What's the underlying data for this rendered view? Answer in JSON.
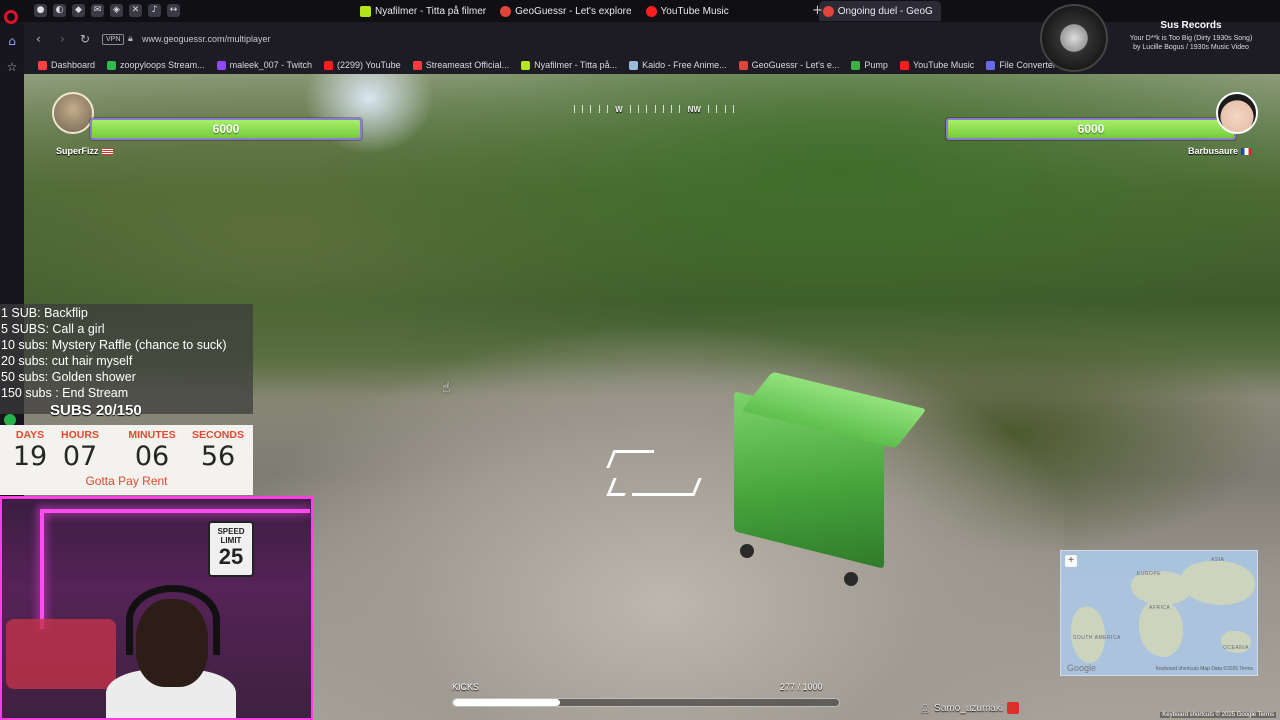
{
  "browser": {
    "tabs": [
      {
        "title": "Nyafilmer - Titta på filmer",
        "color": "#b5e61d"
      },
      {
        "title": "GeoGuessr - Let's explore",
        "color": "#e0453a"
      },
      {
        "title": "YouTube Music",
        "color": "#ff1e1e"
      },
      {
        "title": "Ongoing duel - GeoG",
        "color": "#e0453a",
        "active": true
      }
    ],
    "url": "www.geoguessr.com/multiplayer",
    "vpn_label": "VPN",
    "bookmarks": [
      {
        "label": "Dashboard",
        "color": "#ff4343"
      },
      {
        "label": "zoopyloops Stream...",
        "color": "#2dba4e"
      },
      {
        "label": "maleek_007 - Twitch",
        "color": "#9146ff"
      },
      {
        "label": "(2299) YouTube",
        "color": "#ff1e1e"
      },
      {
        "label": "Streameast Official...",
        "color": "#ff3a3a"
      },
      {
        "label": "Nyafilmer - Titta på...",
        "color": "#b5e61d"
      },
      {
        "label": "Kaido - Free Anime...",
        "color": "#9bd"
      },
      {
        "label": "GeoGuessr - Let's e...",
        "color": "#e0453a"
      },
      {
        "label": "Pump",
        "color": "#3cb043"
      },
      {
        "label": "YouTube Music",
        "color": "#ff1e1e"
      },
      {
        "label": "File Converter - Free...",
        "color": "#6a6af0"
      }
    ]
  },
  "now_playing": {
    "title": "Sus Records",
    "line1": "Your D**k is Too Big (Dirty 1930s Song)",
    "line2": "by Lucille Bogus / 1930s Music Video"
  },
  "duel": {
    "left_player": {
      "name": "SuperFizz",
      "health": "6000",
      "health_fraction": 1.0
    },
    "right_player": {
      "name": "Barbusaure",
      "health": "6000",
      "health_fraction": 1.0
    },
    "compass": [
      "W",
      "NW"
    ]
  },
  "kicks": {
    "label": "KICKS",
    "count": "277 / 1000",
    "fraction": 0.277
  },
  "chat_user": "Samo_uzumaki",
  "minimap": {
    "labels": [
      "ASIA",
      "EUROPE",
      "AFRICA",
      "SOUTH AMERICA",
      "OCEANIA"
    ],
    "google": "Google",
    "attribution": "Keyboard shortcuts   Map Data ©2025   Terms",
    "zoom": "+"
  },
  "footer_attribution": "Keyboard shortcuts  © 2025 Google  Terms",
  "sub_goals": [
    "1 SUB: Backflip",
    "5 SUBS: Call a girl",
    "10 subs: Mystery Raffle (chance to suck)",
    "20 subs: cut hair myself",
    "50 subs: Golden shower",
    "150 subs : End Stream"
  ],
  "subs_progress": "SUBS 20/150",
  "countdown": {
    "days_label": "DAYS",
    "days": "19",
    "hours_label": "HOURS",
    "hours": "07",
    "minutes_label": "MINUTES",
    "minutes": "06",
    "seconds_label": "SECONDS",
    "seconds": "56",
    "note": "Gotta Pay Rent"
  },
  "webcam": {
    "sign_top": "SPEED LIMIT",
    "sign_number": "25"
  }
}
